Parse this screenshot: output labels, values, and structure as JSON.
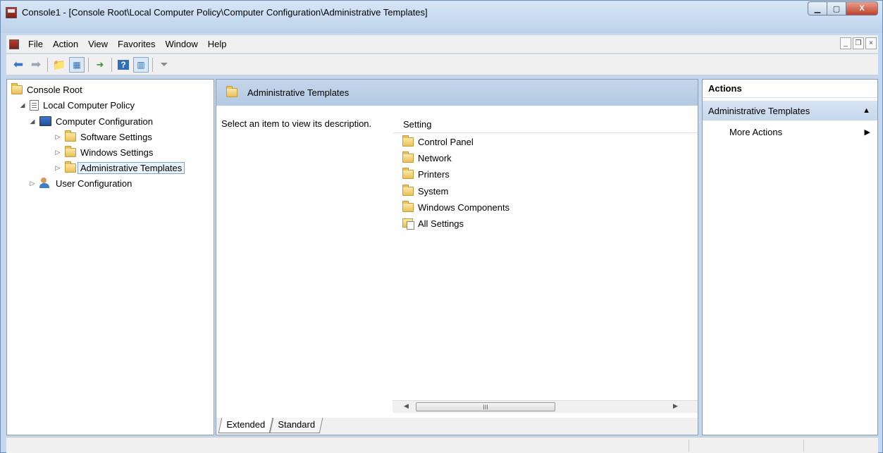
{
  "window": {
    "title": "Console1 - [Console Root\\Local Computer Policy\\Computer Configuration\\Administrative Templates]",
    "close_glyph": "X"
  },
  "menu": {
    "items": [
      "File",
      "Action",
      "View",
      "Favorites",
      "Window",
      "Help"
    ]
  },
  "tree": {
    "root": "Console Root",
    "local_policy": "Local Computer Policy",
    "computer_config": "Computer Configuration",
    "software_settings": "Software Settings",
    "windows_settings": "Windows Settings",
    "admin_templates": "Administrative Templates",
    "user_config": "User Configuration"
  },
  "center": {
    "header": "Administrative Templates",
    "description": "Select an item to view its description.",
    "column": "Setting",
    "items": [
      "Control Panel",
      "Network",
      "Printers",
      "System",
      "Windows Components",
      "All Settings"
    ],
    "tabs": [
      "Extended",
      "Standard"
    ],
    "scroll_grip": "III"
  },
  "actions": {
    "header": "Actions",
    "section": "Administrative Templates",
    "more": "More Actions"
  },
  "icons": {
    "folder": "folder-icon",
    "policy": "policy-icon",
    "computer": "computer-icon",
    "user": "user-icon",
    "all_settings": "all-settings-icon"
  },
  "colors": {
    "header_blue": "#c4d6ea",
    "selection": "#eaf2fb"
  }
}
